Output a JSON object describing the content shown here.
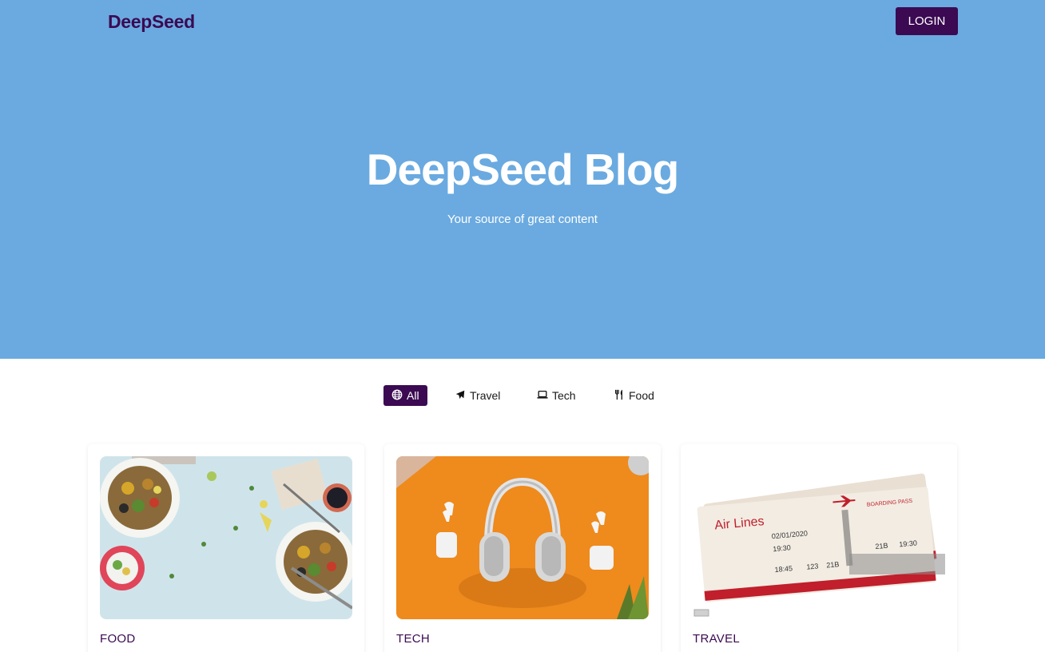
{
  "header": {
    "brand": "DeepSeed",
    "login_label": "LOGIN"
  },
  "hero": {
    "title": "DeepSeed Blog",
    "subtitle": "Your source of great content"
  },
  "filters": [
    {
      "label": "All",
      "icon": "globe-icon",
      "active": true
    },
    {
      "label": "Travel",
      "icon": "airplane-icon",
      "active": false
    },
    {
      "label": "Tech",
      "icon": "laptop-icon",
      "active": false
    },
    {
      "label": "Food",
      "icon": "utensils-icon",
      "active": false
    }
  ],
  "cards": [
    {
      "category": "FOOD",
      "image": "food-photo"
    },
    {
      "category": "TECH",
      "image": "headphones-photo"
    },
    {
      "category": "TRAVEL",
      "image": "boarding-pass-photo"
    }
  ],
  "colors": {
    "hero_bg": "#6aaae0",
    "accent": "#3b0a52",
    "white": "#ffffff"
  }
}
